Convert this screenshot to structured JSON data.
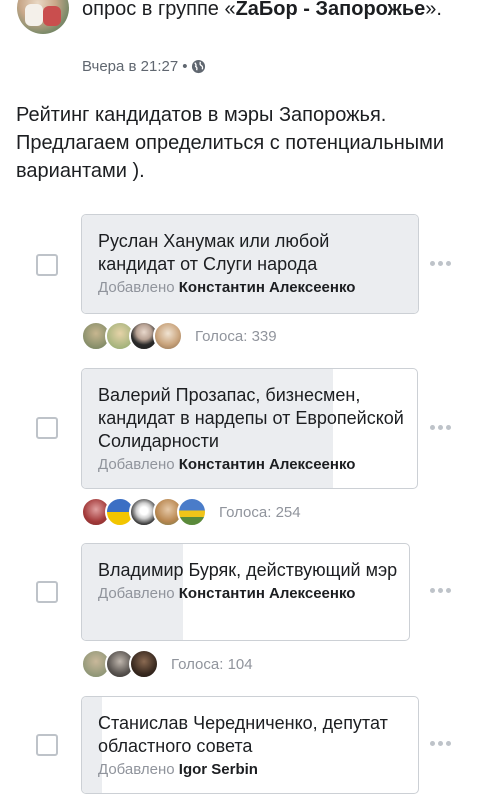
{
  "post": {
    "heading_prefix": "опрос в группе «",
    "group_name": "ZaБор - Запорожье",
    "heading_suffix": "».",
    "time": "Вчера в 21:27",
    "separator": "•",
    "privacy_icon": "globe-icon",
    "text": "Рейтинг кандидатов в мэры Запорожья. Предлагаем определиться с потенциальными вариантами )."
  },
  "poll": {
    "added_label": "Добавлено",
    "votes_prefix": "Голоса: ",
    "options": [
      {
        "title": "Руслан Ханумак или любой кандидат от Слуги народа",
        "author": "Константин Алексеенко",
        "votes_label": "Голоса: 339",
        "votes": 339,
        "fill_fraction": 1.0,
        "voter_avatars": 4
      },
      {
        "title": "Валерий Прозапас, бизнесмен, кандидат в нардепы от Европейской Солидарности",
        "author": "Константин Алексеенко",
        "votes_label": "Голоса: 254",
        "votes": 254,
        "fill_fraction": 0.75,
        "voter_avatars": 5
      },
      {
        "title": "Владимир Буряк, действующий мэр",
        "author": "Константин Алексеенко",
        "votes_label": "Голоса: 104",
        "votes": 104,
        "fill_fraction": 0.31,
        "voter_avatars": 3
      },
      {
        "title": "Станислав Чередниченко, депутат областного совета",
        "author": "Igor Serbin",
        "votes_label": "",
        "votes": null,
        "fill_fraction": 0.06,
        "voter_avatars": 0
      }
    ]
  },
  "colors": {
    "text": "#1c1e21",
    "secondary": "#606770",
    "muted": "#90949c",
    "card_border": "#ccd0d5",
    "card_fill": "#ebedf0",
    "checkbox_border": "#bec3c9"
  }
}
